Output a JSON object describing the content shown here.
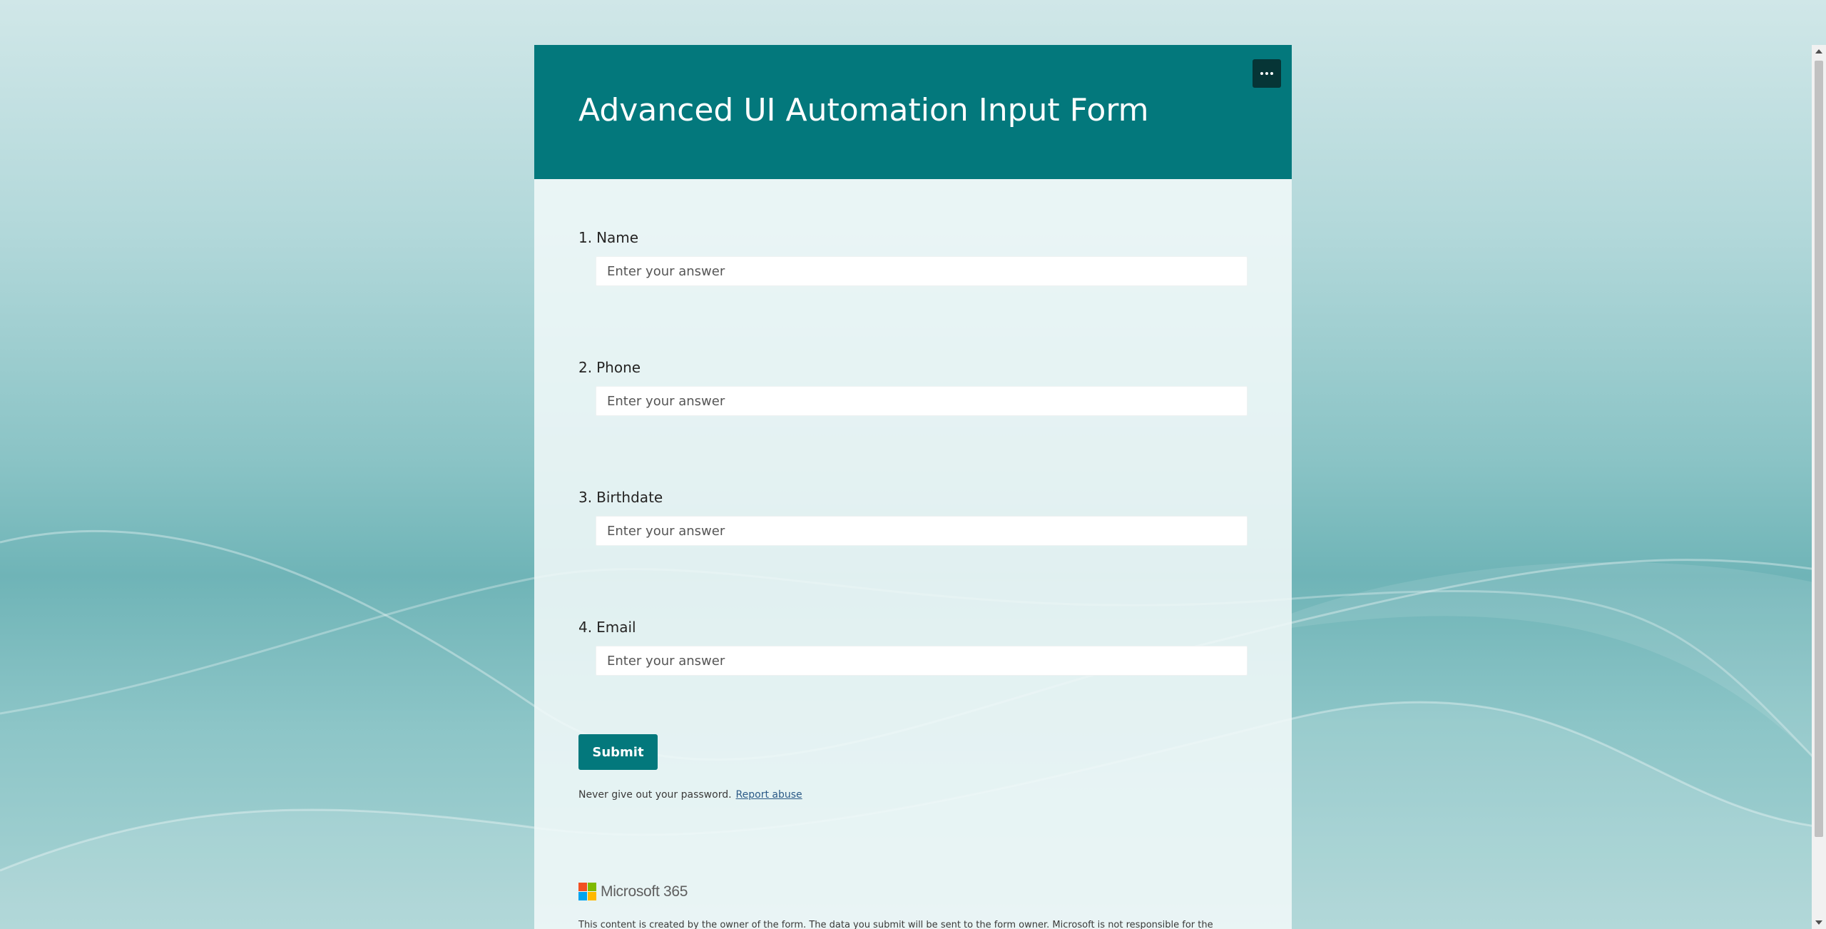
{
  "form": {
    "title": "Advanced UI Automation Input Form",
    "more_options_icon": "more-horizontal-icon",
    "colors": {
      "header": "#03787c",
      "more_button": "#063536",
      "submit": "#03787c"
    }
  },
  "questions": [
    {
      "number": "1.",
      "label": "Name",
      "placeholder": "Enter your answer"
    },
    {
      "number": "2.",
      "label": "Phone",
      "placeholder": "Enter your answer"
    },
    {
      "number": "3.",
      "label": "Birthdate",
      "placeholder": "Enter your answer"
    },
    {
      "number": "4.",
      "label": "Email",
      "placeholder": "Enter your answer"
    }
  ],
  "submit_label": "Submit",
  "footer": {
    "password_note": "Never give out your password.",
    "report_link": "Report abuse",
    "brand_name": "Microsoft 365",
    "brand_logo_icon": "microsoft-logo-icon",
    "brand_logo_colors": [
      "#f25022",
      "#7fba00",
      "#00a4ef",
      "#ffb900"
    ],
    "disclaimer": "This content is created by the owner of the form. The data you submit will be sent to the form owner. Microsoft is not responsible for the"
  }
}
